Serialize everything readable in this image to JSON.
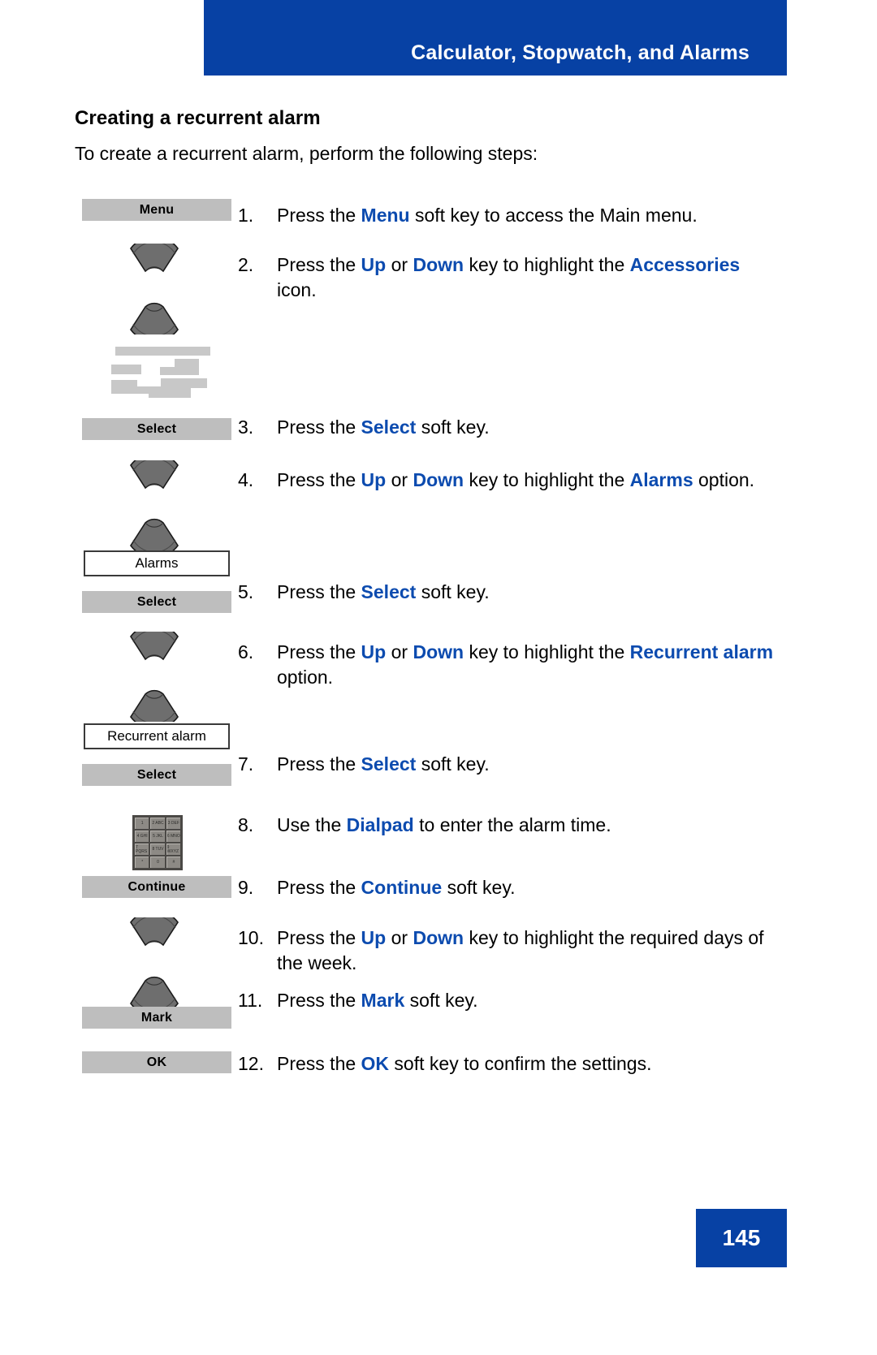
{
  "header": {
    "title": "Calculator, Stopwatch, and Alarms",
    "banner_color": "#0741A4"
  },
  "section": {
    "heading": "Creating a recurrent alarm",
    "intro": "To create a recurrent alarm, perform the following steps:"
  },
  "accent_color": "#0C4BAF",
  "softkeys": {
    "menu": "Menu",
    "select1": "Select",
    "select2": "Select",
    "select3": "Select",
    "continue": "Continue",
    "mark": "Mark",
    "ok": "OK"
  },
  "optionboxes": {
    "alarms": "Alarms",
    "recurrent_alarm": "Recurrent alarm"
  },
  "dialpad": {
    "keys": [
      "1",
      "2 ABC",
      "3 DEF",
      "4 GHI",
      "5 JKL",
      "6 MNO",
      "7 PQRS",
      "8 TUV",
      "9 WXYZ",
      "*",
      "0",
      "#"
    ]
  },
  "steps": [
    {
      "number": "1.",
      "parts": [
        {
          "t": "Press the ",
          "b": false
        },
        {
          "t": "Menu",
          "b": true
        },
        {
          "t": " soft key to access the Main menu.",
          "b": false
        }
      ]
    },
    {
      "number": "2.",
      "parts": [
        {
          "t": "Press the ",
          "b": false
        },
        {
          "t": "Up",
          "b": true
        },
        {
          "t": " or ",
          "b": false
        },
        {
          "t": "Down",
          "b": true
        },
        {
          "t": " key to highlight the ",
          "b": false
        },
        {
          "t": "Accessories",
          "b": true
        },
        {
          "t": " icon.",
          "b": false
        }
      ]
    },
    {
      "number": "3.",
      "parts": [
        {
          "t": "Press the ",
          "b": false
        },
        {
          "t": "Select",
          "b": true
        },
        {
          "t": " soft key.",
          "b": false
        }
      ]
    },
    {
      "number": "4.",
      "parts": [
        {
          "t": "Press the ",
          "b": false
        },
        {
          "t": "Up",
          "b": true
        },
        {
          "t": " or ",
          "b": false
        },
        {
          "t": "Down",
          "b": true
        },
        {
          "t": " key to highlight the ",
          "b": false
        },
        {
          "t": "Alarms",
          "b": true
        },
        {
          "t": " option.",
          "b": false
        }
      ]
    },
    {
      "number": "5.",
      "parts": [
        {
          "t": "Press the ",
          "b": false
        },
        {
          "t": "Select",
          "b": true
        },
        {
          "t": " soft key.",
          "b": false
        }
      ]
    },
    {
      "number": "6.",
      "parts": [
        {
          "t": "Press the ",
          "b": false
        },
        {
          "t": "Up",
          "b": true
        },
        {
          "t": " or ",
          "b": false
        },
        {
          "t": "Down",
          "b": true
        },
        {
          "t": " key to highlight the ",
          "b": false
        },
        {
          "t": "Recurrent alarm",
          "b": true
        },
        {
          "t": " option.",
          "b": false
        }
      ]
    },
    {
      "number": "7.",
      "parts": [
        {
          "t": "Press the ",
          "b": false
        },
        {
          "t": "Select",
          "b": true
        },
        {
          "t": " soft key.",
          "b": false
        }
      ]
    },
    {
      "number": "8.",
      "parts": [
        {
          "t": "Use the ",
          "b": false
        },
        {
          "t": "Dialpad",
          "b": true
        },
        {
          "t": " to enter the alarm time.",
          "b": false
        }
      ]
    },
    {
      "number": "9.",
      "parts": [
        {
          "t": "Press the ",
          "b": false
        },
        {
          "t": "Continue",
          "b": true
        },
        {
          "t": " soft key.",
          "b": false
        }
      ]
    },
    {
      "number": "10.",
      "parts": [
        {
          "t": "Press the ",
          "b": false
        },
        {
          "t": "Up",
          "b": true
        },
        {
          "t": " or ",
          "b": false
        },
        {
          "t": "Down",
          "b": true
        },
        {
          "t": " key to highlight the required days of the week.",
          "b": false
        }
      ]
    },
    {
      "number": "11.",
      "parts": [
        {
          "t": "Press the ",
          "b": false
        },
        {
          "t": "Mark",
          "b": true
        },
        {
          "t": " soft key.",
          "b": false
        }
      ]
    },
    {
      "number": "12.",
      "parts": [
        {
          "t": "Press the ",
          "b": false
        },
        {
          "t": "OK",
          "b": true
        },
        {
          "t": " soft key to confirm the settings.",
          "b": false
        }
      ]
    }
  ],
  "footer": {
    "page_number": "145"
  }
}
